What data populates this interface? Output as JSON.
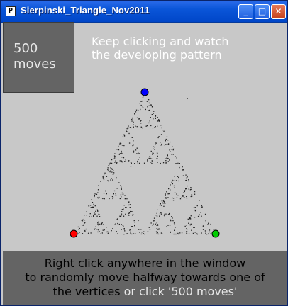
{
  "window": {
    "title": "Sierpinski_Triangle_Nov2011",
    "icon_letter": "P"
  },
  "controls": {
    "minimize_label": "_",
    "maximize_label": "□",
    "close_label": "✕"
  },
  "moves_button": {
    "number": "500",
    "word": "moves"
  },
  "hint": {
    "line1": "Keep clicking and watch",
    "line2": "the developing pattern"
  },
  "info": {
    "line1": "Right click anywhere in the window",
    "line2": "to randomly move halfway towards one of",
    "line3_dark": "the vertices",
    "line3_light": "or click '500 moves'"
  },
  "vertices": [
    {
      "name": "top",
      "color": "#0000ff"
    },
    {
      "name": "bottom-left",
      "color": "#ff0000"
    },
    {
      "name": "bottom-right",
      "color": "#00cc00"
    }
  ],
  "colors": {
    "background": "#c8c8c8",
    "panel": "#646464",
    "title_bar": "#0054e3"
  }
}
